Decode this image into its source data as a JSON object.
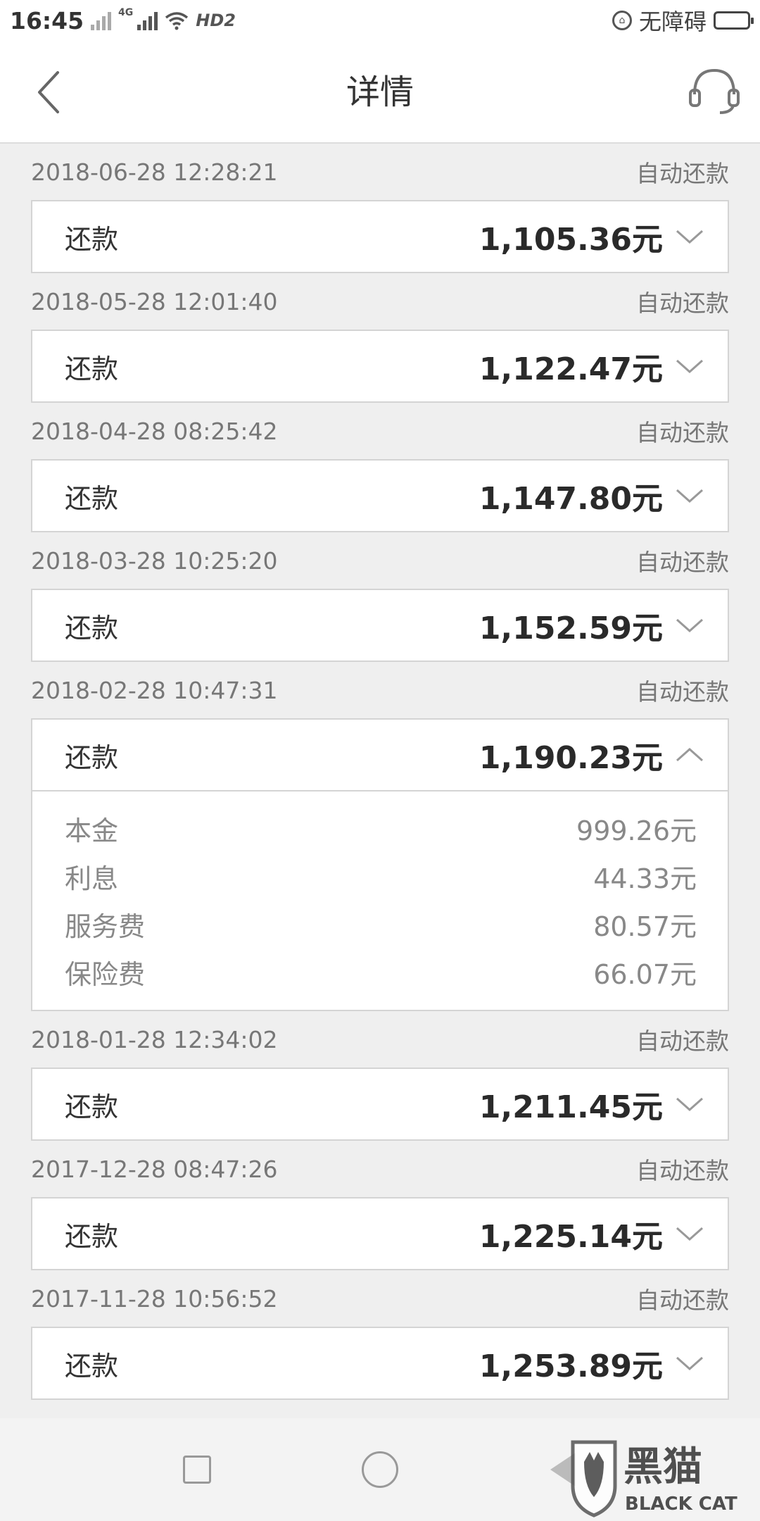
{
  "status_bar": {
    "time": "16:45",
    "network_type": "4G",
    "hd_label": "HD2",
    "accessibility_label": "无障碍"
  },
  "header": {
    "title": "详情",
    "back_icon": "chevron-left-icon",
    "service_icon": "headset-icon"
  },
  "records": [
    {
      "datetime": "2018-06-28 12:28:21",
      "type": "自动还款",
      "label": "还款",
      "amount": "1,105.36元",
      "expanded": false
    },
    {
      "datetime": "2018-05-28 12:01:40",
      "type": "自动还款",
      "label": "还款",
      "amount": "1,122.47元",
      "expanded": false
    },
    {
      "datetime": "2018-04-28 08:25:42",
      "type": "自动还款",
      "label": "还款",
      "amount": "1,147.80元",
      "expanded": false
    },
    {
      "datetime": "2018-03-28 10:25:20",
      "type": "自动还款",
      "label": "还款",
      "amount": "1,152.59元",
      "expanded": false
    },
    {
      "datetime": "2018-02-28 10:47:31",
      "type": "自动还款",
      "label": "还款",
      "amount": "1,190.23元",
      "expanded": true,
      "details": [
        {
          "label": "本金",
          "value": "999.26元"
        },
        {
          "label": "利息",
          "value": "44.33元"
        },
        {
          "label": "服务费",
          "value": "80.57元"
        },
        {
          "label": "保险费",
          "value": "66.07元"
        }
      ]
    },
    {
      "datetime": "2018-01-28 12:34:02",
      "type": "自动还款",
      "label": "还款",
      "amount": "1,211.45元",
      "expanded": false
    },
    {
      "datetime": "2017-12-28 08:47:26",
      "type": "自动还款",
      "label": "还款",
      "amount": "1,225.14元",
      "expanded": false
    },
    {
      "datetime": "2017-11-28 10:56:52",
      "type": "自动还款",
      "label": "还款",
      "amount": "1,253.89元",
      "expanded": false
    }
  ],
  "watermark": {
    "cn_text": "黑猫",
    "en_text": "BLACK CAT"
  },
  "colors": {
    "background": "#efefef",
    "card": "#ffffff",
    "border": "#d4d4d4",
    "text_primary": "#333333",
    "text_secondary": "#777777"
  }
}
